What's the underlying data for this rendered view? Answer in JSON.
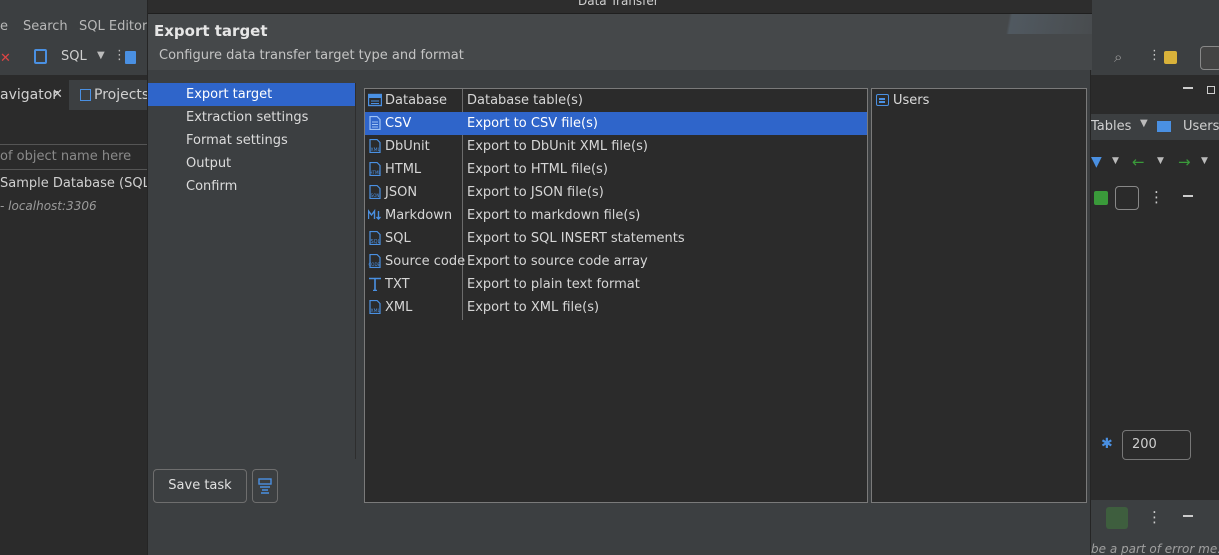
{
  "background": {
    "menu": [
      "e",
      "Search",
      "SQL Editor"
    ],
    "toolbar_sql": "SQL",
    "tabs": [
      "avigator",
      "Projects"
    ],
    "filter_placeholder": "of object name here",
    "tree": [
      "Sample Database (SQLite",
      "- localhost:3306"
    ],
    "right_tabs": [
      "Tables",
      "Users"
    ],
    "limit_value": "200",
    "error_text": "be a part of error me."
  },
  "dialog": {
    "window_title": "Data Transfer",
    "header_title": "Export target",
    "header_desc": "Configure data transfer target type and format",
    "wizard_steps": [
      {
        "label": "Export target",
        "selected": true
      },
      {
        "label": "Extraction settings",
        "selected": false
      },
      {
        "label": "Format settings",
        "selected": false
      },
      {
        "label": "Output",
        "selected": false
      },
      {
        "label": "Confirm",
        "selected": false
      }
    ],
    "formats": [
      {
        "name": "Database",
        "desc": "Database table(s)",
        "icon": "database-table-icon"
      },
      {
        "name": "CSV",
        "desc": "Export to CSV file(s)",
        "icon": "csv-file-icon",
        "selected": true
      },
      {
        "name": "DbUnit",
        "desc": "Export to DbUnit XML file(s)",
        "icon": "xml-file-icon"
      },
      {
        "name": "HTML",
        "desc": "Export to HTML file(s)",
        "icon": "html-file-icon"
      },
      {
        "name": "JSON",
        "desc": "Export to JSON file(s)",
        "icon": "json-file-icon"
      },
      {
        "name": "Markdown",
        "desc": "Export to markdown file(s)",
        "icon": "markdown-icon"
      },
      {
        "name": "SQL",
        "desc": "Export to SQL INSERT statements",
        "icon": "sql-file-icon"
      },
      {
        "name": "Source code",
        "desc": "Export to source code array",
        "icon": "code-file-icon"
      },
      {
        "name": "TXT",
        "desc": "Export to plain text format",
        "icon": "text-icon"
      },
      {
        "name": "XML",
        "desc": "Export to XML file(s)",
        "icon": "xml-file-icon"
      }
    ],
    "tables": [
      "Users"
    ],
    "save_task_label": "Save task"
  },
  "colors": {
    "selection": "#2f65ca",
    "dialog_bg": "#3c3f41",
    "panel_bg": "#2b2b2b",
    "icon_blue": "#4a90e2"
  }
}
